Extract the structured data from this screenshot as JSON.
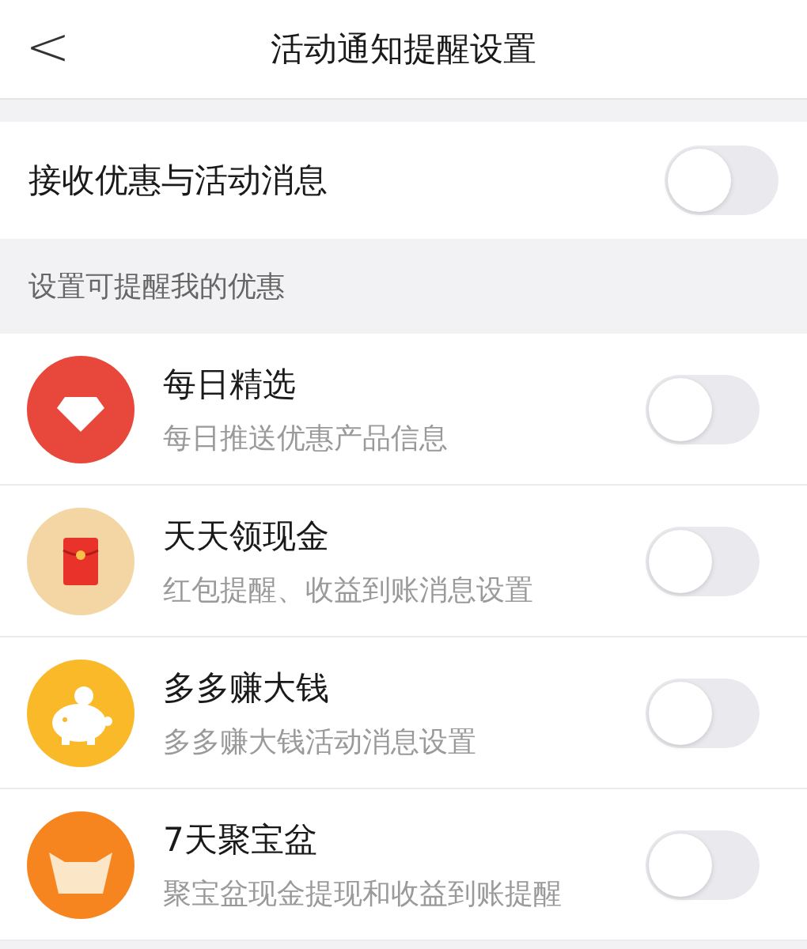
{
  "nav": {
    "back": "<",
    "title": "活动通知提醒设置"
  },
  "master": {
    "label": "接收优惠与活动消息",
    "on": false
  },
  "section": {
    "title": "设置可提醒我的优惠"
  },
  "items": [
    {
      "kind": "diamond",
      "title": "每日精选",
      "subtitle": "每日推送优惠产品信息",
      "on": false
    },
    {
      "kind": "envelope",
      "title": "天天领现金",
      "subtitle": "红包提醒、收益到账消息设置",
      "on": false
    },
    {
      "kind": "piggy",
      "title": "多多赚大钱",
      "subtitle": "多多赚大钱活动消息设置",
      "on": false
    },
    {
      "kind": "ingot",
      "title": "7天聚宝盆",
      "subtitle": "聚宝盆现金提现和收益到账提醒",
      "on": false
    }
  ]
}
